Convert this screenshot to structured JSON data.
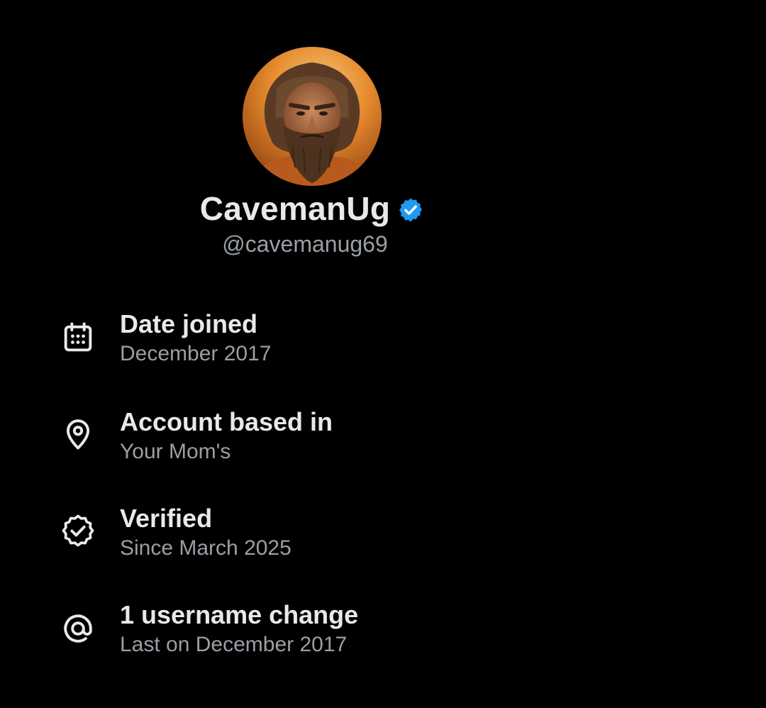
{
  "profile": {
    "display_name": "CavemanUg",
    "handle": "@cavemanug69",
    "verified_icon": "verified-badge-icon",
    "verified_color": "#1d9bf0"
  },
  "about": {
    "items": [
      {
        "icon": "calendar-icon",
        "title": "Date joined",
        "subtitle": "December 2017"
      },
      {
        "icon": "location-pin-icon",
        "title": "Account based in",
        "subtitle": "Your Mom's"
      },
      {
        "icon": "verified-outline-icon",
        "title": "Verified",
        "subtitle": "Since March 2025"
      },
      {
        "icon": "at-sign-icon",
        "title": "1 username change",
        "subtitle": "Last on December 2017"
      }
    ]
  },
  "colors": {
    "background": "#000000",
    "primary_text": "#e7e9ea",
    "secondary_text": "#9a9fa5",
    "accent": "#1d9bf0"
  }
}
